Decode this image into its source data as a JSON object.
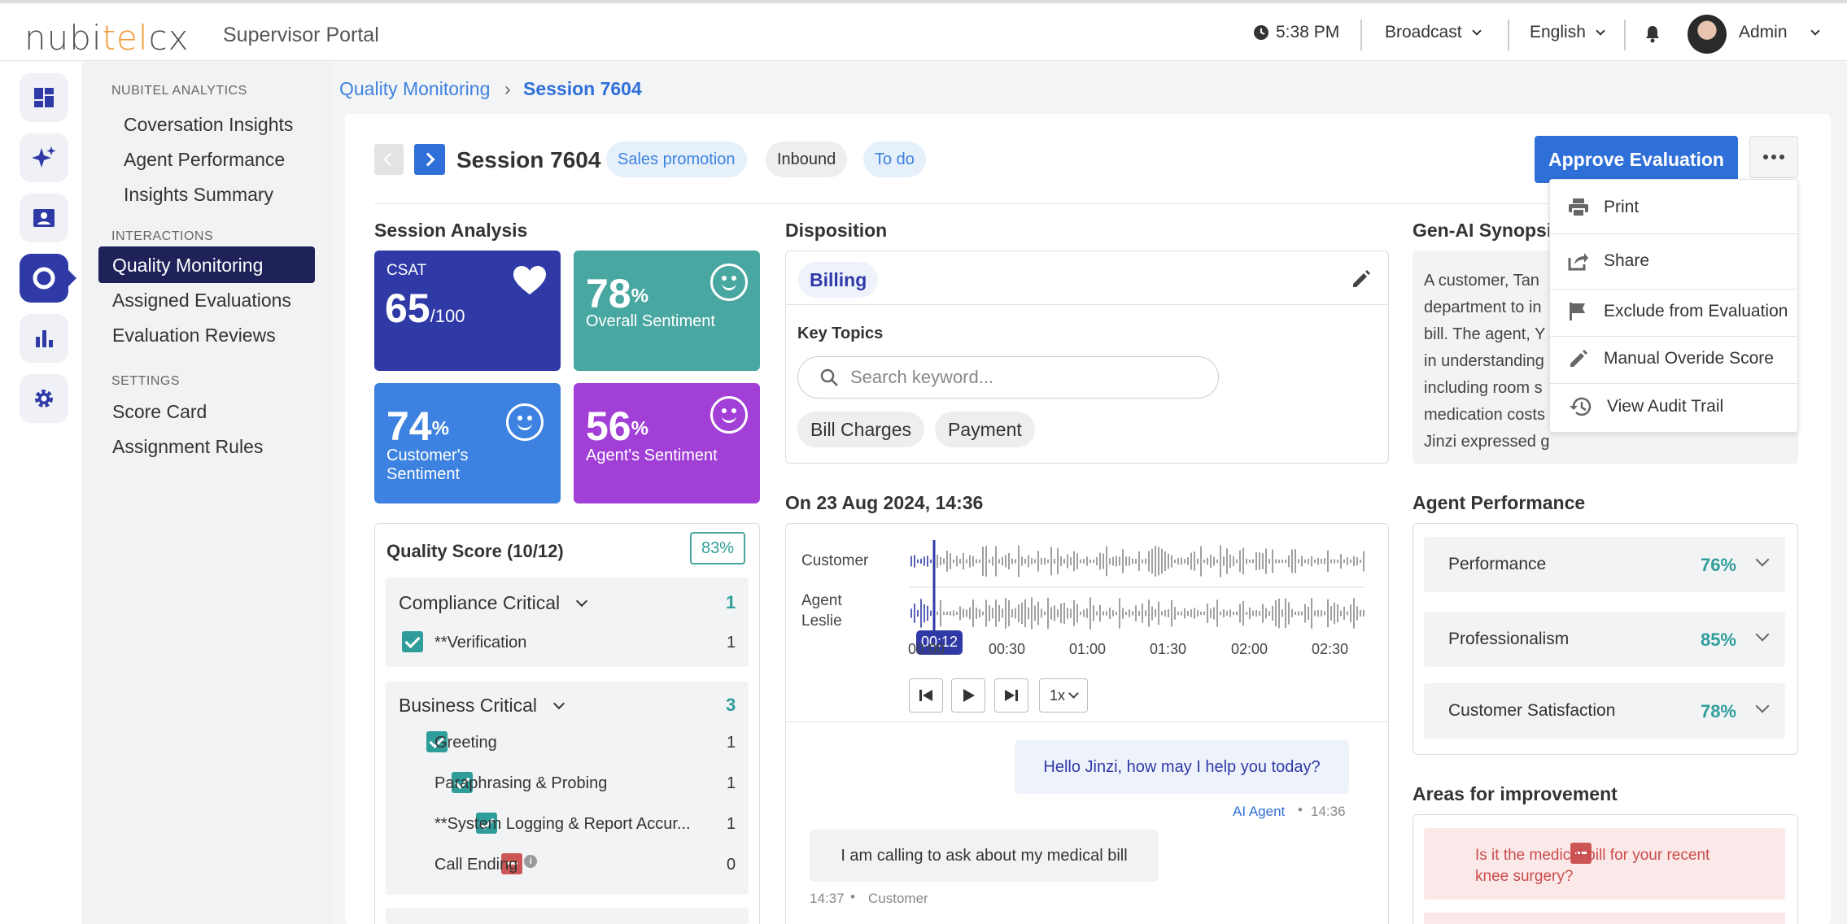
{
  "header": {
    "logo_part1": "nubi",
    "logo_part2": "tel",
    "logo_part3": "cx",
    "portal": "Supervisor Portal",
    "time": "5:38 PM",
    "broadcast": "Broadcast",
    "language": "English",
    "user": "Admin"
  },
  "rail": {
    "icons": [
      "dashboard-icon",
      "sparkle-icon",
      "contact-card-icon",
      "quality-ring-icon",
      "bar-chart-icon",
      "settings-icon"
    ]
  },
  "sidenav": {
    "sec1": "NUBITEL ANALYTICS",
    "items1": [
      "Coversation Insights",
      "Agent Performance",
      "Insights Summary"
    ],
    "sec2": "INTERACTIONS",
    "items2": [
      "Quality Monitoring",
      "Assigned Evaluations",
      "Evaluation Reviews"
    ],
    "sec3": "SETTINGS",
    "items3": [
      "Score Card",
      "Assignment Rules"
    ]
  },
  "breadcrumb": {
    "parent": "Quality Monitoring",
    "sep": "›",
    "current": "Session 7604"
  },
  "session": {
    "title": "Session 7604",
    "tags": [
      "Sales promotion",
      "Inbound",
      "To do"
    ],
    "approve": "Approve Evaluation"
  },
  "menu": {
    "items": [
      "Print",
      "Share",
      "Exclude from Evaluation",
      "Manual Overide Score",
      "View Audit Trail"
    ]
  },
  "analysis": {
    "heading": "Session Analysis",
    "csat_label": "CSAT",
    "csat_value": "65",
    "csat_max": "/100",
    "overall_value": "78",
    "overall_label": "Overall Sentiment",
    "customer_value": "74",
    "customer_label1": "Customer's",
    "customer_label2": "Sentiment",
    "agent_value": "56",
    "agent_label": "Agent's Sentiment",
    "pct": "%"
  },
  "quality": {
    "title": "Quality Score (10/12)",
    "badge": "83%",
    "group1": {
      "name": "Compliance Critical",
      "count": "1",
      "rows": [
        {
          "label": "**Verification",
          "score": "1"
        }
      ]
    },
    "group2": {
      "name": "Business Critical",
      "count": "3",
      "rows": [
        {
          "label": "Greeting",
          "score": "1"
        },
        {
          "label": "Paraphrasing & Probing",
          "score": "1"
        },
        {
          "label": "**System Logging & Report Accur...",
          "score": "1"
        },
        {
          "label": "Call Ending",
          "score": "0"
        }
      ]
    }
  },
  "disposition": {
    "heading": "Disposition",
    "value": "Billing",
    "topics_label": "Key Topics",
    "search_placeholder": "Search keyword...",
    "chips": [
      "Bill Charges",
      "Payment"
    ]
  },
  "recording": {
    "heading": "On 23 Aug 2024, 14:36",
    "track1": "Customer",
    "track2a": "Agent",
    "track2b": "Leslie",
    "playhead": "00:12",
    "ticks": [
      "00:00",
      "00:30",
      "01:00",
      "01:30",
      "02:00",
      "02:30"
    ],
    "speed": "1x"
  },
  "transcript": {
    "msg1": "Hello Jinzi, how may I help you today?",
    "msg1_who": "AI Agent",
    "msg1_time": "14:36",
    "msg2": "I am calling to ask about my medical bill",
    "msg2_time": "14:37",
    "msg2_who": "Customer",
    "bullet": "•"
  },
  "synopsis": {
    "heading": "Gen-AI Synopsis",
    "lines": [
      "A customer, Tan",
      "department to in",
      "bill. The agent, Y",
      "in understanding",
      "including room s",
      "medication costs",
      "Jinzi expressed g"
    ]
  },
  "performance": {
    "heading": "Agent Performance",
    "rows": [
      {
        "label": "Performance",
        "value": "76%"
      },
      {
        "label": "Professionalism",
        "value": "85%"
      },
      {
        "label": "Customer Satisfaction",
        "value": "78%"
      }
    ]
  },
  "improvement": {
    "heading": "Areas for improvement",
    "item1a": "Is it the medical bill for your recent",
    "item1b": "knee surgery?"
  },
  "colors": {
    "primary": "#2f6fd8",
    "navy": "#2f3aa7",
    "teal": "#49a7a1",
    "purple": "#a13fd6",
    "blue_tile": "#3d82e0"
  }
}
